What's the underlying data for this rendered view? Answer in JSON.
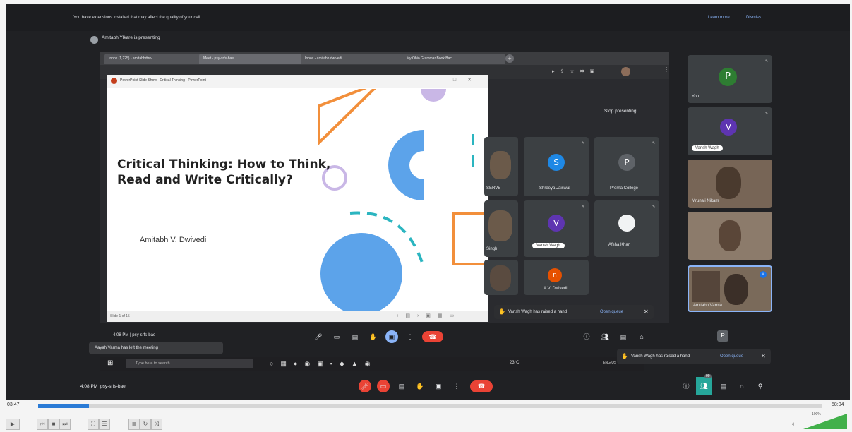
{
  "banner": {
    "message": "You have extensions installed that may affect the quality of your call",
    "learn_more": "Learn more",
    "dismiss": "Dismiss"
  },
  "presenter_line": "Amitabh Ylkare is presenting",
  "browser_tabs": [
    "Inbox (1,225) - amitabhdwiv...",
    "Meet - psy-srfs-bae",
    "Inbox - amitabh.dwivedi...",
    "My Ohio Grammar Book Bac"
  ],
  "ppt_window_title": "PowerPoint Slide Show - Critical Thinking - PowerPoint",
  "slide": {
    "title_line1": "Critical Thinking: How to Think,",
    "title_line2": "Read and Write Critically?",
    "author": "Amitabh V. Dwivedi"
  },
  "ppt_status": "Slide 1 of 15",
  "stop_presenting": "Stop presenting",
  "tiles": [
    {
      "letter": "",
      "name": "SERVE",
      "color": "#6b5a4a"
    },
    {
      "letter": "S",
      "name": "Shreeya Jaiswal",
      "color": "#1e88e5"
    },
    {
      "letter": "P",
      "name": "Prerna College",
      "color": "#5f6368"
    },
    {
      "letter": "",
      "name": "Singh",
      "color": "#6b5a4a"
    },
    {
      "letter": "V",
      "name": "Vansh Wagh",
      "color": "#5e35b1"
    },
    {
      "letter": "",
      "name": "Afsha Khan",
      "color": "#f1f3f4"
    },
    {
      "letter": "",
      "name": "",
      "color": "#5a4b40"
    },
    {
      "letter": "n",
      "name": "A.V. Dwivedi",
      "color": "#e65100"
    }
  ],
  "sidebar": [
    {
      "letter": "P",
      "name": "You",
      "color": "#2e7d32"
    },
    {
      "letter": "V",
      "name": "Vansh Wagh",
      "color": "#5e35b1"
    },
    {
      "letter": "",
      "name": "Mrunali Nikam",
      "color": "#6a5848"
    },
    {
      "letter": "",
      "name": "",
      "color": "#8c7b6b"
    },
    {
      "letter": "",
      "name": "Amitabh Varma",
      "color": "#7a6a5a"
    }
  ],
  "notifications": {
    "inner_raise": "Vansh Wagh has raised a hand",
    "open_queue": "Open queue",
    "outer_raise": "Vansh Wagh has raised a hand",
    "left_meeting": "Aayah Varma has left the meeting",
    "outer_open_queue": "Open queue"
  },
  "inner_meeting_label": "4:08 PM | psy-srfs-bae",
  "outer_bar": {
    "time": "4:08 PM",
    "code": "psy-srfs-bae"
  },
  "people_count": "99",
  "taskbar": {
    "search_placeholder": "Type here to search",
    "temp": "23°C",
    "lang": "ENG US"
  },
  "player": {
    "current": "03:47",
    "total": "58:04",
    "volume": "100%",
    "progress": 0.065
  }
}
